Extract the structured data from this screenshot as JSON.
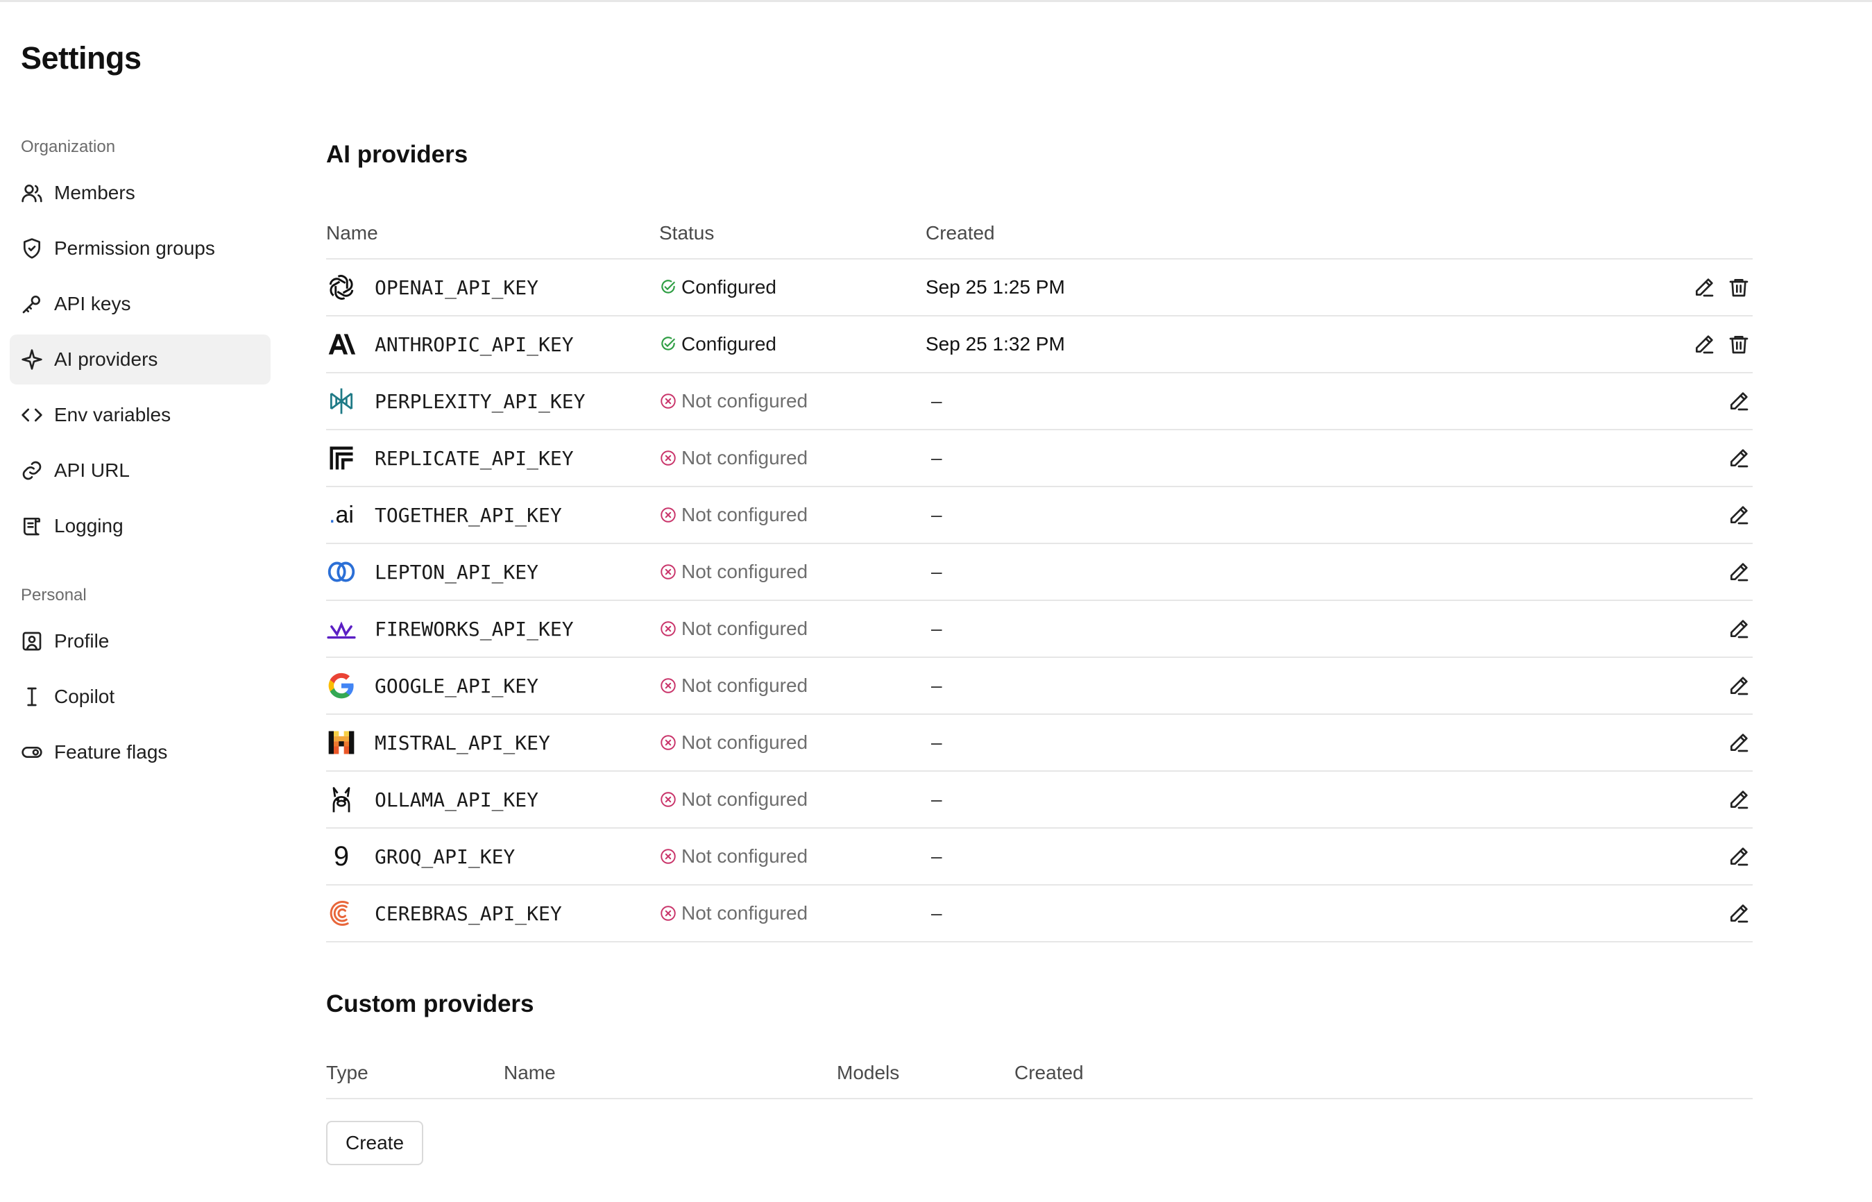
{
  "page": {
    "title": "Settings"
  },
  "sidebar": {
    "sections": [
      {
        "label": "Organization",
        "items": [
          {
            "label": "Members",
            "icon": "users-icon"
          },
          {
            "label": "Permission groups",
            "icon": "shield-icon"
          },
          {
            "label": "API keys",
            "icon": "key-icon"
          },
          {
            "label": "AI providers",
            "icon": "sparkle-icon",
            "active": true
          },
          {
            "label": "Env variables",
            "icon": "code-icon"
          },
          {
            "label": "API URL",
            "icon": "link-icon"
          },
          {
            "label": "Logging",
            "icon": "scroll-icon"
          }
        ]
      },
      {
        "label": "Personal",
        "items": [
          {
            "label": "Profile",
            "icon": "profile-icon"
          },
          {
            "label": "Copilot",
            "icon": "text-cursor-icon"
          },
          {
            "label": "Feature flags",
            "icon": "toggle-icon"
          }
        ]
      }
    ]
  },
  "ai_providers": {
    "title": "AI providers",
    "columns": {
      "name": "Name",
      "status": "Status",
      "created": "Created"
    },
    "rows": [
      {
        "key": "OPENAI_API_KEY",
        "logo": "openai-logo",
        "status": "Configured",
        "configured": true,
        "created": "Sep 25 1:25 PM"
      },
      {
        "key": "ANTHROPIC_API_KEY",
        "logo": "anthropic-logo",
        "status": "Configured",
        "configured": true,
        "created": "Sep 25 1:32 PM"
      },
      {
        "key": "PERPLEXITY_API_KEY",
        "logo": "perplexity-logo",
        "status": "Not configured",
        "configured": false,
        "created": "–"
      },
      {
        "key": "REPLICATE_API_KEY",
        "logo": "replicate-logo",
        "status": "Not configured",
        "configured": false,
        "created": "–"
      },
      {
        "key": "TOGETHER_API_KEY",
        "logo": "together-logo",
        "logo_text": ".ai",
        "status": "Not configured",
        "configured": false,
        "created": "–"
      },
      {
        "key": "LEPTON_API_KEY",
        "logo": "lepton-logo",
        "status": "Not configured",
        "configured": false,
        "created": "–"
      },
      {
        "key": "FIREWORKS_API_KEY",
        "logo": "fireworks-logo",
        "status": "Not configured",
        "configured": false,
        "created": "–"
      },
      {
        "key": "GOOGLE_API_KEY",
        "logo": "google-logo",
        "status": "Not configured",
        "configured": false,
        "created": "–"
      },
      {
        "key": "MISTRAL_API_KEY",
        "logo": "mistral-logo",
        "status": "Not configured",
        "configured": false,
        "created": "–"
      },
      {
        "key": "OLLAMA_API_KEY",
        "logo": "ollama-logo",
        "status": "Not configured",
        "configured": false,
        "created": "–"
      },
      {
        "key": "GROQ_API_KEY",
        "logo": "groq-logo",
        "logo_text": "9",
        "status": "Not configured",
        "configured": false,
        "created": "–"
      },
      {
        "key": "CEREBRAS_API_KEY",
        "logo": "cerebras-logo",
        "status": "Not configured",
        "configured": false,
        "created": "–"
      }
    ]
  },
  "custom_providers": {
    "title": "Custom providers",
    "columns": {
      "type": "Type",
      "name": "Name",
      "models": "Models",
      "created": "Created"
    },
    "create_label": "Create"
  },
  "colors": {
    "configured_green": "#2f9e44",
    "not_configured_red": "#c9346a",
    "active_nav_bg": "#f1f1f1",
    "divider": "#e6e6e6"
  }
}
